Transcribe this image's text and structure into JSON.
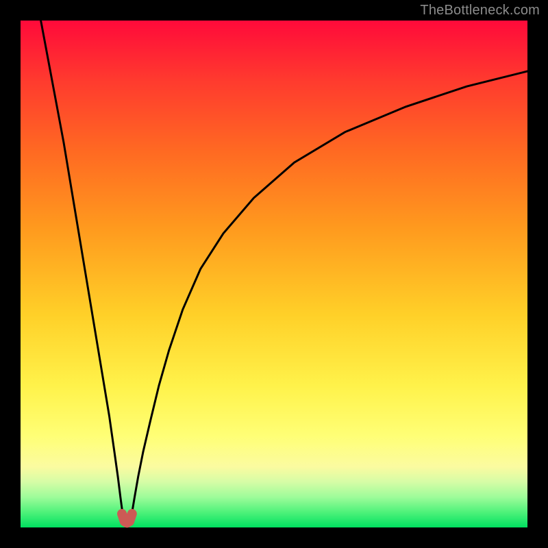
{
  "watermark": "TheBottleneck.com",
  "colors": {
    "frame": "#000000",
    "curve": "#000000",
    "marker": "#cc5a55",
    "gradient_top": "#ff0a3a",
    "gradient_bottom": "#00e060"
  },
  "chart_data": {
    "type": "line",
    "title": "",
    "xlabel": "",
    "ylabel": "",
    "xlim": [
      0,
      100
    ],
    "ylim": [
      0,
      100
    ],
    "grid": false,
    "legend": false,
    "series": [
      {
        "name": "left-branch",
        "x": [
          4.0,
          5.5,
          7.0,
          8.5,
          10.0,
          11.5,
          13.0,
          14.5,
          16.0,
          17.5,
          18.5,
          19.2,
          19.7,
          20.1,
          20.4
        ],
        "y": [
          100,
          92,
          84,
          76,
          67,
          58,
          49,
          40,
          31,
          22,
          15,
          10,
          6,
          3,
          1.5
        ]
      },
      {
        "name": "right-branch",
        "x": [
          21.6,
          22.0,
          22.5,
          23.2,
          24.2,
          25.6,
          27.3,
          29.3,
          32.0,
          35.5,
          40.0,
          46.0,
          54.0,
          64.0,
          76.0,
          88.0,
          100.0
        ],
        "y": [
          1.5,
          3,
          6,
          10,
          15,
          21,
          28,
          35,
          43,
          51,
          58,
          65,
          72,
          78,
          83,
          87,
          90
        ]
      },
      {
        "name": "min-marker",
        "x": [
          20.0,
          20.5,
          21.0,
          21.5,
          22.0
        ],
        "y": [
          2.7,
          1.2,
          0.9,
          1.2,
          2.7
        ]
      }
    ]
  }
}
